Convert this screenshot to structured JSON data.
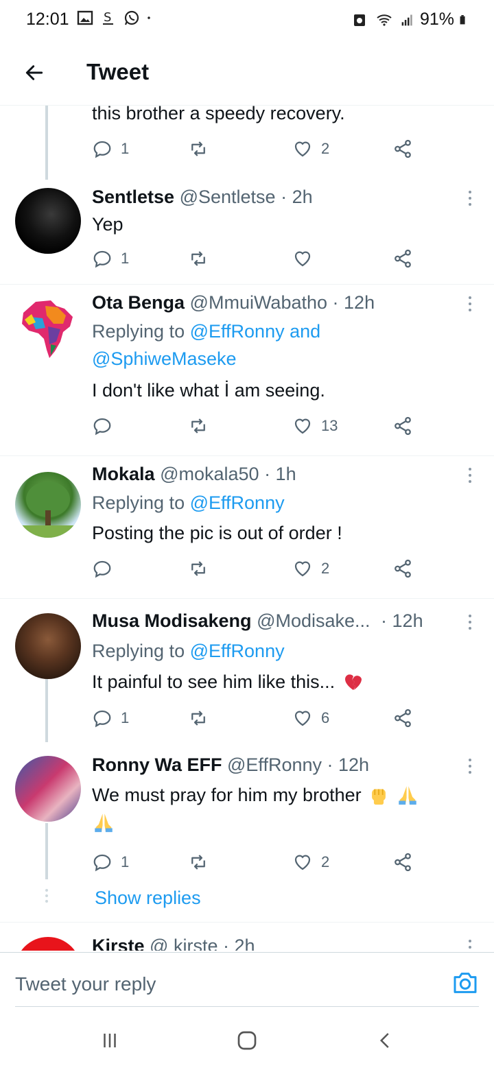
{
  "status_bar": {
    "time": "12:01",
    "battery": "91%",
    "icons_left": [
      "gallery-icon",
      "s-icon",
      "whatsapp-icon",
      "dot-icon"
    ],
    "icons_right": [
      "alarm-icon",
      "wifi-icon",
      "signal-icon",
      "battery-icon"
    ]
  },
  "header": {
    "title": "Tweet"
  },
  "partial_tweet": {
    "text": "this brother a speedy recovery.",
    "reply_count": "1",
    "like_count": "2"
  },
  "tweets": [
    {
      "name": "Sentletse",
      "handle": "@Sentletse",
      "time": "· 2h",
      "text": "Yep",
      "reply_count": "1",
      "like_count": ""
    },
    {
      "name": "Ota Benga",
      "handle": "@MmuiWabatho",
      "time": "· 12h",
      "replying_prefix": "Replying to",
      "replying_to_1": "@EffRonny",
      "replying_and": "and",
      "replying_to_2": "@SphiweMaseke",
      "text": "I don't like what İ am seeing.",
      "reply_count": "",
      "like_count": "13"
    },
    {
      "name": "Mokala",
      "handle": "@mokala50",
      "time": "· 1h",
      "replying_prefix": "Replying to",
      "replying_to_1": "@EffRonny",
      "text": "Posting the pic is out of order !",
      "reply_count": "",
      "like_count": "2"
    },
    {
      "name": "Musa Modisakeng",
      "handle": "@Modisake...",
      "time": "· 12h",
      "replying_prefix": "Replying to",
      "replying_to_1": "@EffRonny",
      "text": "It painful to see him like this...",
      "reply_count": "1",
      "like_count": "6"
    },
    {
      "name": "Ronny Wa EFF",
      "handle": "@EffRonny",
      "time": "· 12h",
      "text": "We must pray for him my brother",
      "reply_count": "1",
      "like_count": "2"
    },
    {
      "name": "Kirste",
      "handle": "@ kirste",
      "time": "· 2h"
    }
  ],
  "show_replies": "Show replies",
  "compose": {
    "placeholder": "Tweet your reply"
  },
  "colors": {
    "accent": "#1d9bf0",
    "secondary_text": "#536471",
    "divider": "#eff3f4"
  }
}
